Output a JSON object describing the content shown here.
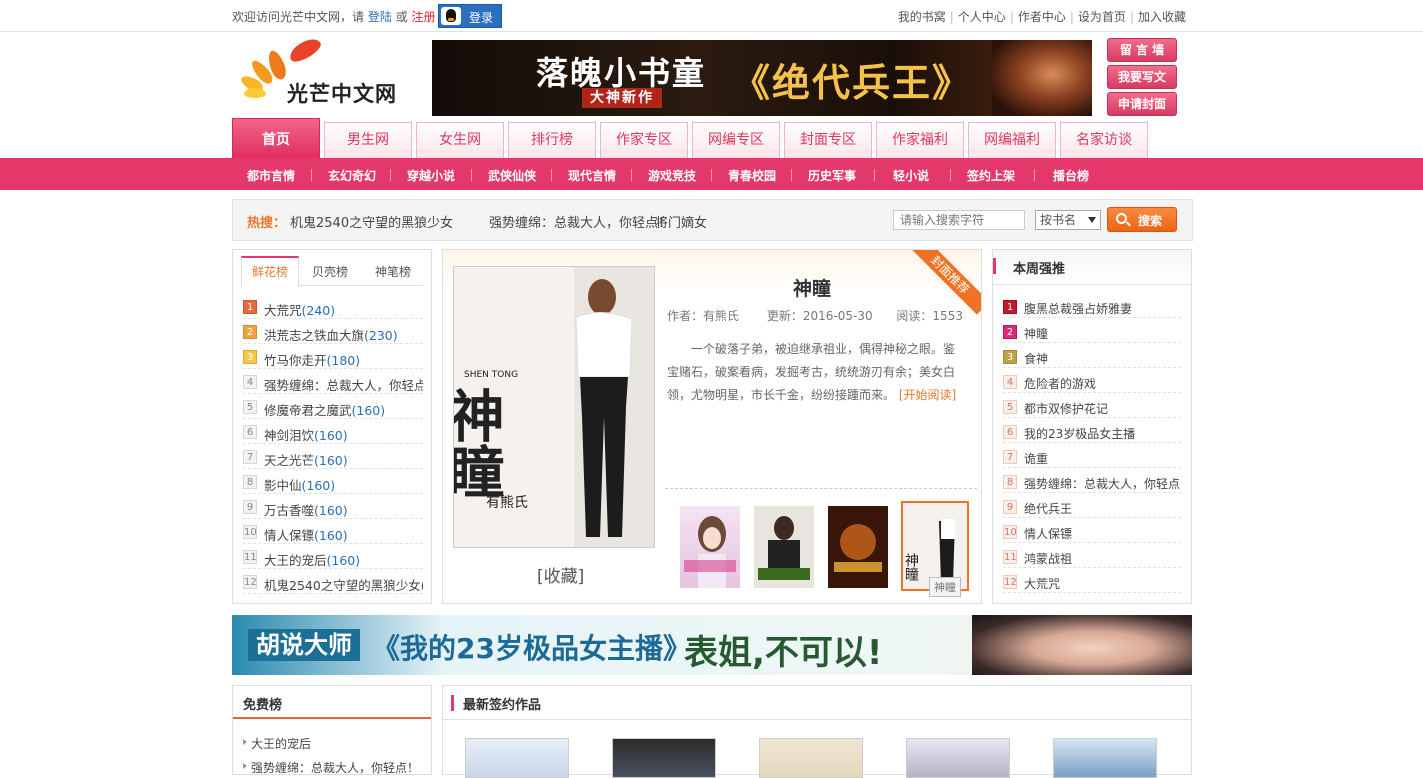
{
  "topbar": {
    "welcome": "欢迎访问光芒中文网，请",
    "login_link": "登陆",
    "or": "或",
    "register_link": "注册",
    "qq_login": "登录",
    "links": [
      "我的书窝",
      "个人中心",
      "作者中心",
      "设为首页",
      "加入收藏"
    ]
  },
  "logo": {
    "text": "光芒中文网"
  },
  "banner": {
    "title": "落魄小书童",
    "tag": "大神新作",
    "book": "《绝代兵王》"
  },
  "side_buttons": [
    "留 言 墙",
    "我要写文",
    "申请封面"
  ],
  "nav": {
    "tabs": [
      "首页",
      "男生网",
      "女生网",
      "排行榜",
      "作家专区",
      "网编专区",
      "封面专区",
      "作家福利",
      "网编福利",
      "名家访谈"
    ]
  },
  "subnav": {
    "items": [
      "都市言情",
      "玄幻奇幻",
      "穿越小说",
      "武侠仙侠",
      "现代言情",
      "游戏竞技",
      "青春校园",
      "历史军事",
      "轻小说",
      "签约上架",
      "播台榜"
    ]
  },
  "search": {
    "hot_label": "热搜：",
    "hot_items": [
      "机鬼2540之守望的黑狼少女",
      "强势缠绵：总裁大人，你轻点！",
      "将门嫡女"
    ],
    "placeholder": "请输入搜索字符",
    "select_value": "按书名",
    "button": "搜索"
  },
  "left_rank": {
    "tabs": [
      "鲜花榜",
      "贝壳榜",
      "神笔榜"
    ],
    "items": [
      {
        "n": "1",
        "name": "大荒咒",
        "count": "(240)"
      },
      {
        "n": "2",
        "name": "洪荒志之铁血大旗",
        "count": "(230)"
      },
      {
        "n": "3",
        "name": "竹马你走开",
        "count": "(180)"
      },
      {
        "n": "4",
        "name": "强势缠绵：总裁大人，你轻点",
        "count": ""
      },
      {
        "n": "5",
        "name": "修魔帝君之魔武",
        "count": "(160)"
      },
      {
        "n": "6",
        "name": "神剑泪饮",
        "count": "(160)"
      },
      {
        "n": "7",
        "name": "天之光芒",
        "count": "(160)"
      },
      {
        "n": "8",
        "name": "影中仙",
        "count": "(160)"
      },
      {
        "n": "9",
        "name": "万古香噬",
        "count": "(160)"
      },
      {
        "n": "10",
        "name": "情人保镖",
        "count": "(160)"
      },
      {
        "n": "11",
        "name": "大王的宠后",
        "count": "(160)"
      },
      {
        "n": "12",
        "name": "机鬼2540之守望的黑狼少女(1",
        "count": ""
      }
    ]
  },
  "featured": {
    "ribbon": "封面推荐",
    "title": "神瞳",
    "author": "作者：有熊氏",
    "updated": "更新：2016-05-30",
    "reads": "阅读：1553",
    "desc": "一个破落子弟，被迫继承祖业，偶得神秘之眼。鉴宝赌石，破案看病，发掘考古，统统游刃有余；美女白领，尤物明星，市长千金，纷纷接踵而来。",
    "read_link": "[开始阅读]",
    "favorite": "[收藏]",
    "cover_title": "神瞳",
    "cover_pinyin": "SHEN TONG",
    "cover_author": "有熊氏",
    "thumb_tooltip": "神瞳"
  },
  "right_rank": {
    "title": "本周强推",
    "items": [
      {
        "n": "1",
        "name": "腹黑总裁强占娇雅妻"
      },
      {
        "n": "2",
        "name": "神瞳"
      },
      {
        "n": "3",
        "name": "食神"
      },
      {
        "n": "4",
        "name": "危险者的游戏"
      },
      {
        "n": "5",
        "name": "都市双修护花记"
      },
      {
        "n": "6",
        "name": "我的23岁极品女主播"
      },
      {
        "n": "7",
        "name": "诡重"
      },
      {
        "n": "8",
        "name": "强势缠绵：总裁大人，你轻点"
      },
      {
        "n": "9",
        "name": "绝代兵王"
      },
      {
        "n": "10",
        "name": "情人保镖"
      },
      {
        "n": "11",
        "name": "鸿蒙战祖"
      },
      {
        "n": "12",
        "name": "大荒咒"
      }
    ]
  },
  "ad": {
    "author": "胡说大师",
    "book": "《我的23岁极品女主播》",
    "slogan": "表姐,不可以!"
  },
  "free_rank": {
    "title": "免费榜",
    "items": [
      "大王的宠后",
      "强势缠绵：总裁大人，你轻点！"
    ]
  },
  "signed": {
    "title": "最新签约作品"
  }
}
